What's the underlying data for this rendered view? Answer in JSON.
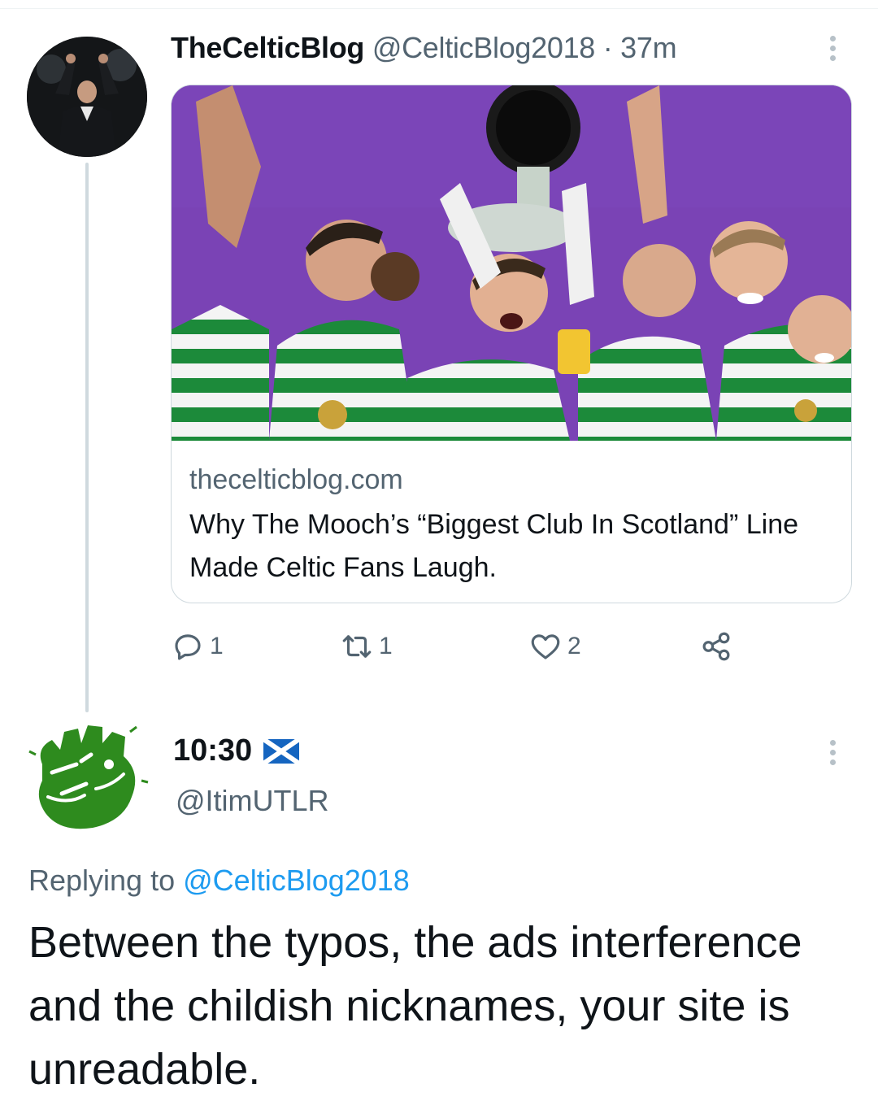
{
  "tweet1": {
    "display_name": "TheCelticBlog",
    "handle": "@CelticBlog2018",
    "separator": "·",
    "time": "37m",
    "card": {
      "domain": "thecelticblog.com",
      "title": "Why The Mooch’s “Biggest Club In Scotland” Line Made Celtic Fans Laugh."
    },
    "actions": {
      "replies": "1",
      "retweets": "1",
      "likes": "2"
    }
  },
  "tweet2": {
    "display_name": "10:30",
    "handle": "@ItimUTLR",
    "replying_prefix": "Replying to",
    "replying_to": "@CelticBlog2018",
    "text": "Between the typos, the ads interference and the childish nicknames, your site is unreadable."
  },
  "colors": {
    "secondary_text": "#536471",
    "link_blue": "#1d9bf0",
    "celtic_green": "#1c8a3a",
    "card_purple": "#6a3ca0"
  },
  "icons": {
    "more": "more-vertical-icon",
    "reply": "reply-icon",
    "retweet": "retweet-icon",
    "like": "heart-icon",
    "share": "share-icon",
    "flag": "scotland-flag-icon"
  }
}
